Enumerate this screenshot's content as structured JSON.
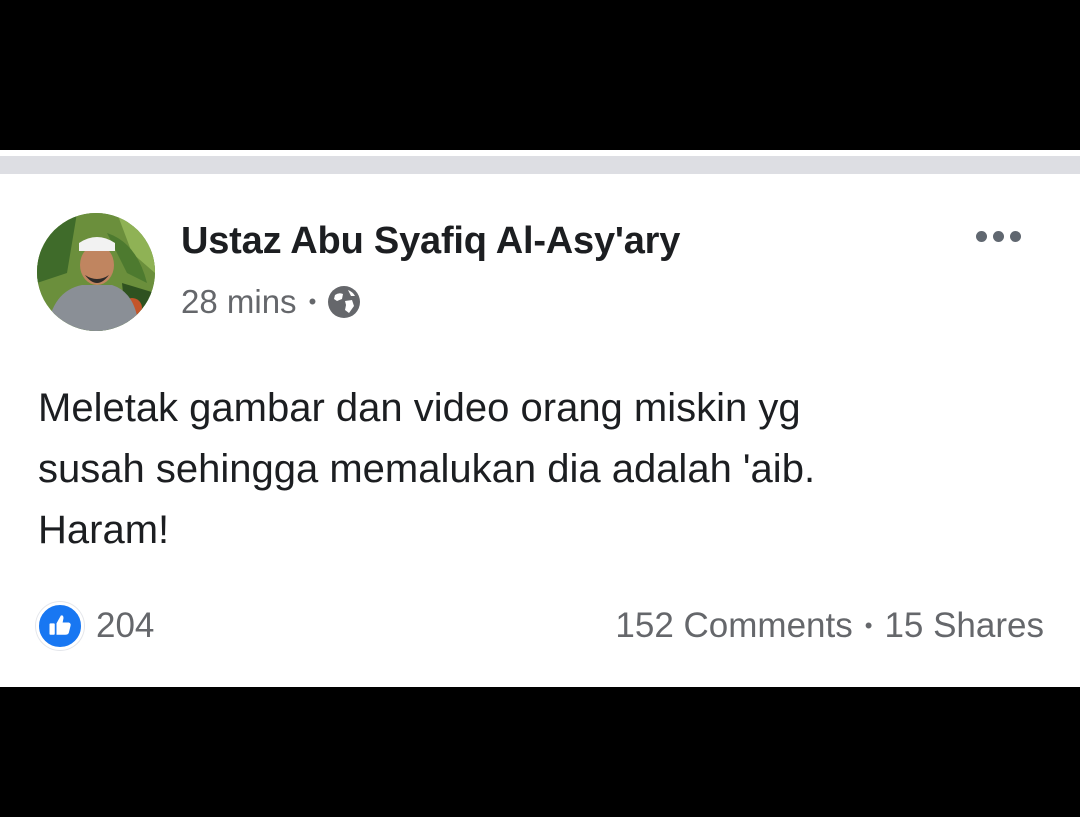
{
  "post": {
    "author": "Ustaz Abu Syafiq Al-Asy'ary",
    "time": "28 mins",
    "separator": "•",
    "privacy_icon": "globe-icon",
    "more_icon": "more-horizontal-icon",
    "body_lines": [
      "Meletak gambar dan video orang miskin yg",
      "susah sehingga memalukan dia adalah 'aib.",
      "Haram!"
    ],
    "reactions": {
      "icon": "like-icon",
      "count": "204"
    },
    "comments": "152 Comments",
    "shares": "15 Shares"
  },
  "colors": {
    "background": "#000000",
    "card": "#ffffff",
    "divider": "#dddee3",
    "like_blue": "#1877f2",
    "secondary_text": "#65676b",
    "primary_text": "#1c1e21"
  }
}
